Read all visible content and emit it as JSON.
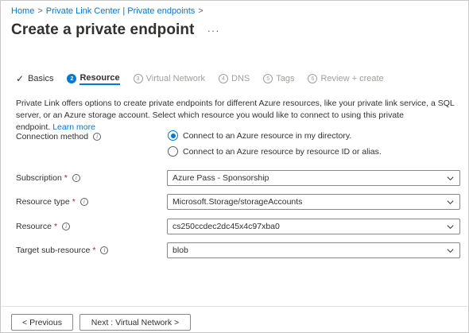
{
  "breadcrumb": {
    "home": "Home",
    "sep1": ">",
    "plc": "Private Link Center | Private endpoints",
    "sep2": ">"
  },
  "page": {
    "title": "Create a private endpoint",
    "more": "···"
  },
  "tabs": [
    {
      "marker": "✓",
      "label": "Basics",
      "state": "done"
    },
    {
      "marker": "2",
      "label": "Resource",
      "state": "active"
    },
    {
      "marker": "3",
      "label": "Virtual Network",
      "state": "pending"
    },
    {
      "marker": "4",
      "label": "DNS",
      "state": "pending"
    },
    {
      "marker": "5",
      "label": "Tags",
      "state": "pending"
    },
    {
      "marker": "6",
      "label": "Review + create",
      "state": "pending"
    }
  ],
  "description": {
    "text": "Private Link offers options to create private endpoints for different Azure resources, like your private link service, a SQL server, or an Azure storage account. Select which resource you would like to connect to using this private endpoint.",
    "link": "Learn more"
  },
  "connection": {
    "label": "Connection method",
    "options": [
      {
        "label": "Connect to an Azure resource in my directory.",
        "selected": true
      },
      {
        "label": "Connect to an Azure resource by resource ID or alias.",
        "selected": false
      }
    ]
  },
  "fields": {
    "subscription": {
      "label": "Subscription",
      "required": "*",
      "value": "Azure Pass - Sponsorship"
    },
    "resource_type": {
      "label": "Resource type",
      "required": "*",
      "value": "Microsoft.Storage/storageAccounts"
    },
    "resource": {
      "label": "Resource",
      "required": "*",
      "value": "cs250ccdec2dc45x4c97xba0"
    },
    "target_sub_resource": {
      "label": "Target sub-resource",
      "required": "*",
      "value": "blob"
    }
  },
  "info_glyph": "i",
  "footer": {
    "previous": "< Previous",
    "next": "Next : Virtual Network >"
  },
  "colors": {
    "accent": "#0078d4",
    "required": "#a4262c",
    "text": "#323130",
    "disabled": "#a19f9d",
    "border": "#8a8886"
  }
}
